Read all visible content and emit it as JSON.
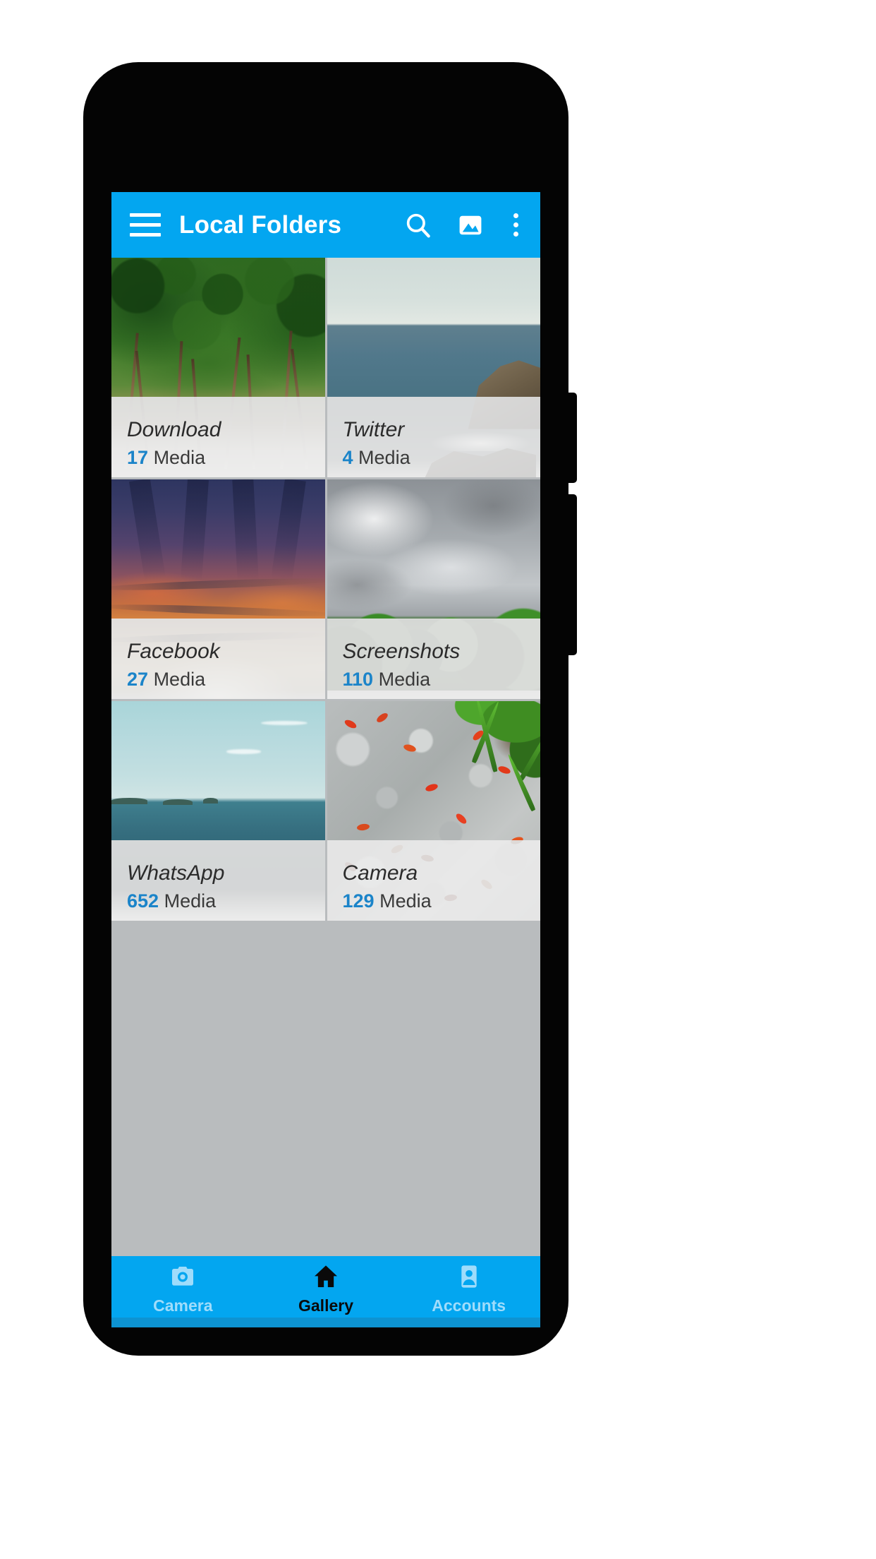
{
  "device": {
    "frame_color": "#040404",
    "screen_bg": "#d9dbdc"
  },
  "theme": {
    "accent": "#03a6f0",
    "accent_dark": "#0d93d2",
    "count_blue": "#1b84c9",
    "label_text": "#2b2b2b",
    "nav_inactive": "#9fdcfb",
    "nav_active": "#0a0a0a"
  },
  "app_bar": {
    "title": "Local Folders",
    "menu_icon": "hamburger-menu-icon",
    "search_icon": "search-icon",
    "gallery_icon": "image-picture-icon",
    "overflow_icon": "more-vertical-kebab-icon"
  },
  "folders": [
    {
      "name": "Download",
      "count": "17",
      "unit": "Media",
      "scene": "forest",
      "scene_alt": "green forest canopy with blue sky and sandy path"
    },
    {
      "name": "Twitter",
      "count": "4",
      "unit": "Media",
      "scene": "coast",
      "scene_alt": "grey ocean with rocky cliff headland on the right"
    },
    {
      "name": "Facebook",
      "count": "27",
      "unit": "Media",
      "scene": "sunset",
      "scene_alt": "orange and purple sunset sky with glowing horizon"
    },
    {
      "name": "Screenshots",
      "count": "110",
      "unit": "Media",
      "scene": "storm",
      "scene_alt": "heavy grey storm clouds over a green treeline"
    },
    {
      "name": "WhatsApp",
      "count": "652",
      "unit": "Media",
      "scene": "sea",
      "scene_alt": "pale blue sky over calm teal sea with distant islands"
    },
    {
      "name": "Camera",
      "count": "129",
      "unit": "Media",
      "scene": "gravel",
      "scene_alt": "grey gravel stones scattered with red flower petals and green grass"
    }
  ],
  "bottom_nav": [
    {
      "label": "Camera",
      "icon": "camera-icon",
      "active": false
    },
    {
      "label": "Gallery",
      "icon": "home-icon",
      "active": true
    },
    {
      "label": "Accounts",
      "icon": "account-contact-card-icon",
      "active": false
    }
  ]
}
